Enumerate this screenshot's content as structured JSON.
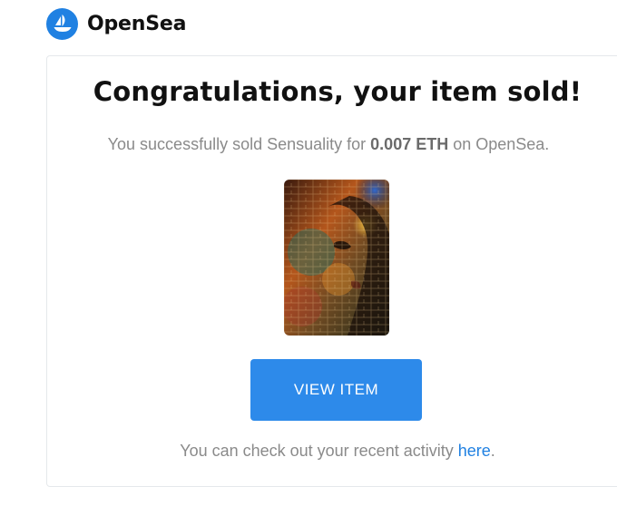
{
  "brand": {
    "name": "OpenSea",
    "logo_icon": "opensea-boat-icon",
    "accent_color": "#2081e2"
  },
  "email": {
    "title": "Congratulations, your item sold!",
    "subtitle_prefix": "You successfully sold Sensuality for ",
    "amount": "0.007 ETH",
    "subtitle_suffix": " on OpenSea.",
    "item_image_icon": "nft-artwork-image",
    "view_button_label": "VIEW ITEM",
    "button_color": "#2d8aea",
    "footer_prefix": "You can check out your recent activity ",
    "footer_link": "here",
    "footer_suffix": "."
  }
}
